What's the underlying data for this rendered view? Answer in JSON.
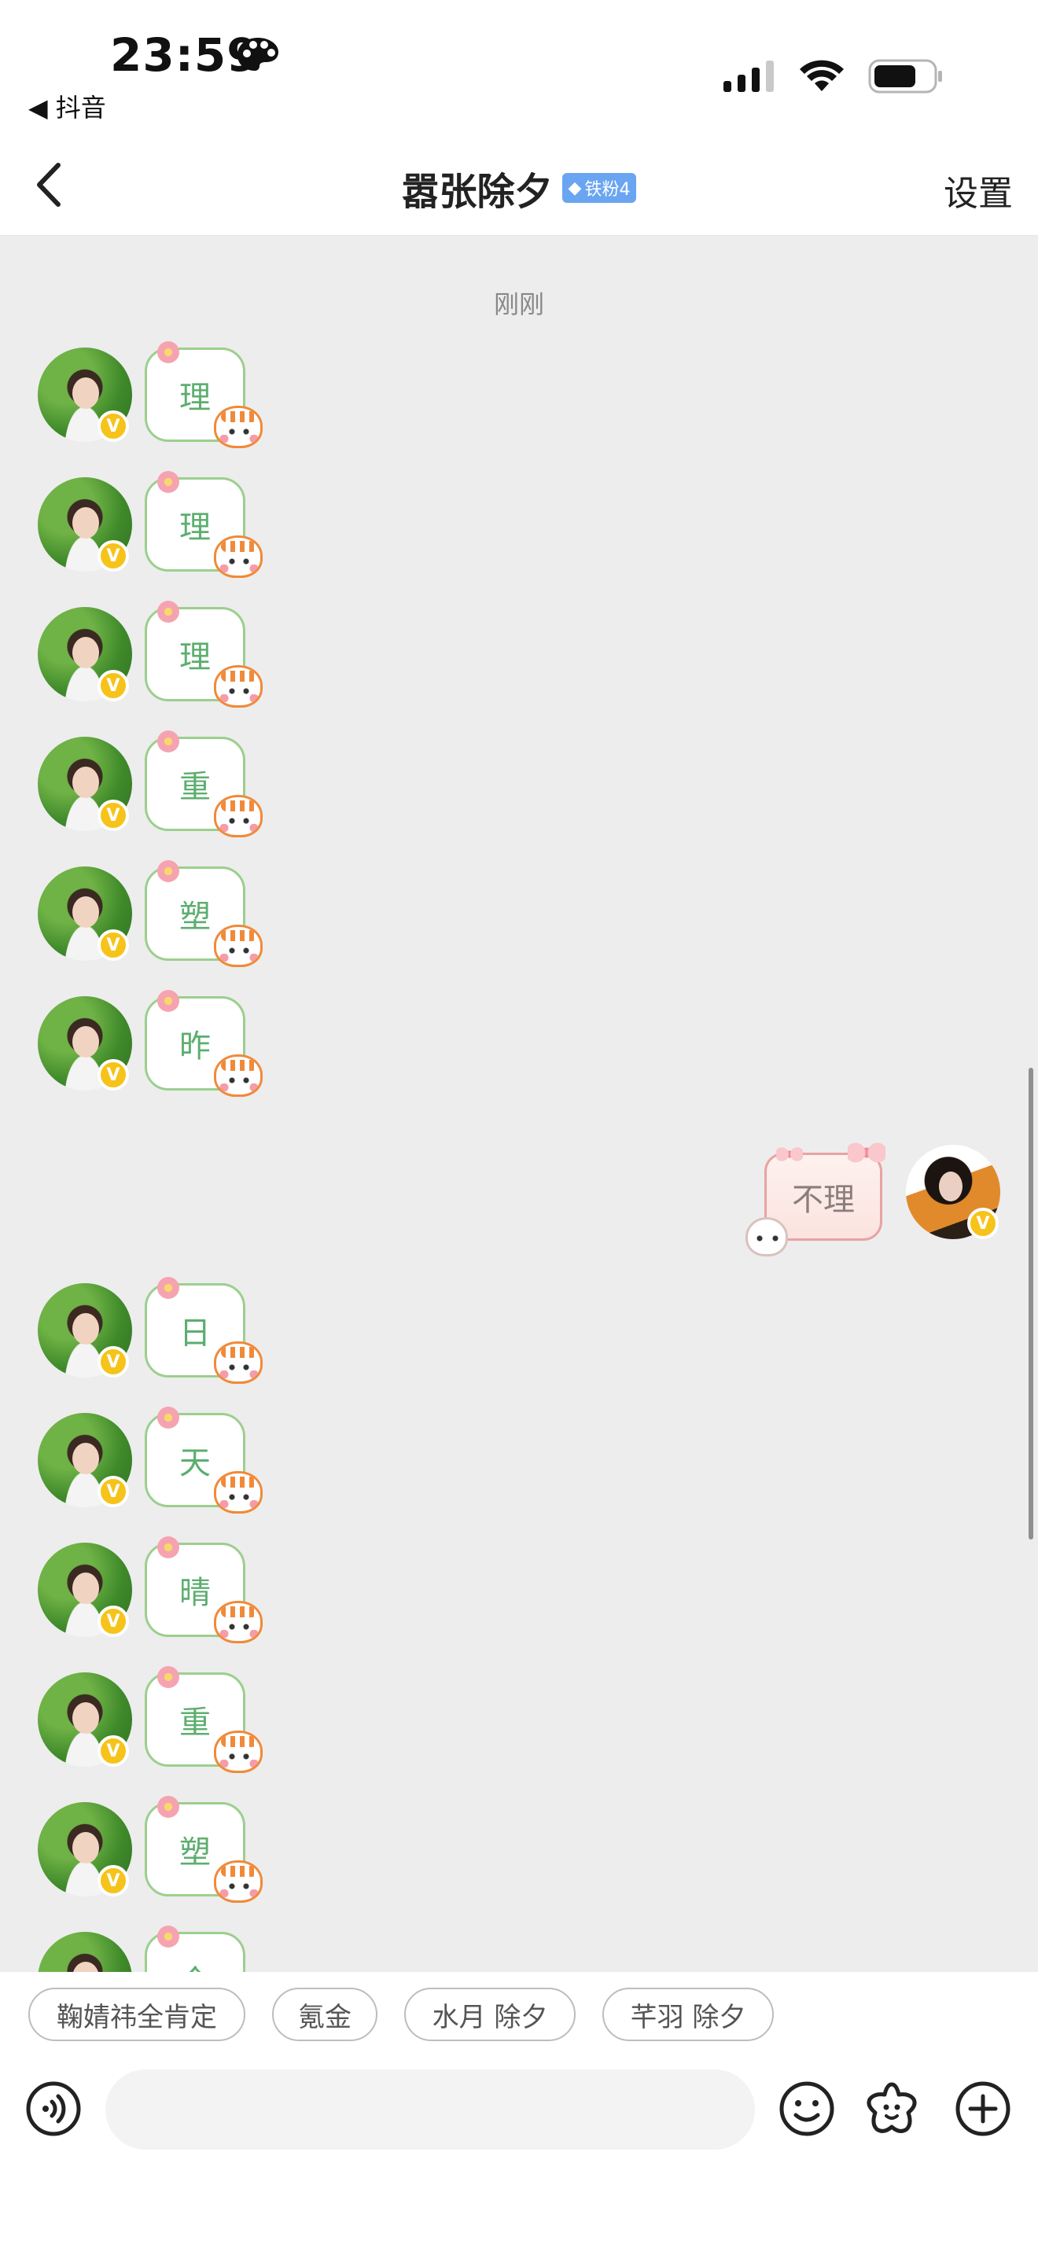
{
  "status_bar": {
    "time": "23:59",
    "back_app": "◀ 抖音"
  },
  "nav": {
    "title": "嚣张除夕",
    "fan_badge": "铁粉4",
    "settings": "设置"
  },
  "chat": {
    "timestamp": "刚刚",
    "incoming_group_1": [
      "理",
      "理",
      "理",
      "重",
      "塑",
      "昨"
    ],
    "outgoing": "不理",
    "incoming_group_2": [
      "日",
      "天",
      "晴",
      "重",
      "塑",
      "今"
    ]
  },
  "quick_replies": [
    "鞠婧祎全肯定",
    "氪金",
    "水月 除夕",
    "芊羽 除夕"
  ],
  "input": {
    "placeholder": ""
  },
  "colors": {
    "incoming_text": "#5cae6f",
    "incoming_border": "#9ccf8e",
    "outgoing_border": "#e8a3a3",
    "verified_badge": "#f6c31b",
    "fan_badge": "#6aa5f2"
  },
  "icons": [
    "palette-icon",
    "signal-icon",
    "wifi-icon",
    "battery-icon",
    "back-arrow-icon",
    "voice-icon",
    "emoji-icon",
    "sticker-icon",
    "plus-icon"
  ]
}
